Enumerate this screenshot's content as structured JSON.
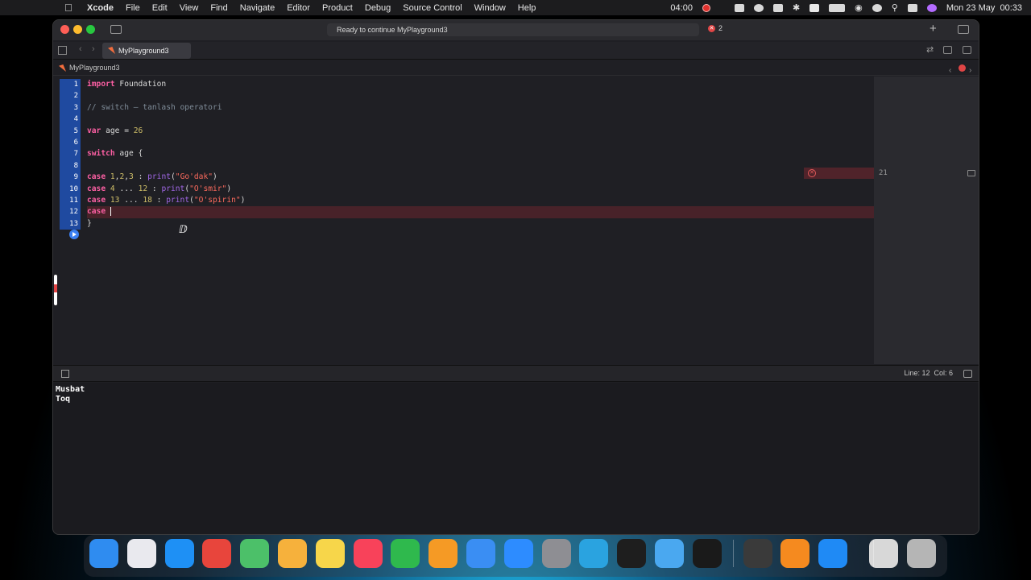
{
  "menubar": {
    "app_name": "Xcode",
    "items": [
      "File",
      "Edit",
      "View",
      "Find",
      "Navigate",
      "Editor",
      "Product",
      "Debug",
      "Source Control",
      "Window",
      "Help"
    ],
    "record_time": "04:00",
    "clock": "Mon 23 May  00:33"
  },
  "window": {
    "activity_text": "Ready to continue MyPlayground3",
    "error_count": "2",
    "tab_title": "MyPlayground3",
    "breadcrumb": "MyPlayground3"
  },
  "editor": {
    "lines": [
      {
        "n": "1",
        "tokens": [
          {
            "t": "kw",
            "v": "import"
          },
          {
            "t": "id",
            "v": " Foundation"
          }
        ]
      },
      {
        "n": "2",
        "tokens": []
      },
      {
        "n": "3",
        "tokens": [
          {
            "t": "cm",
            "v": "// switch – tanlash operatori"
          }
        ]
      },
      {
        "n": "4",
        "tokens": []
      },
      {
        "n": "5",
        "tokens": [
          {
            "t": "kw",
            "v": "var"
          },
          {
            "t": "id",
            "v": " age = "
          },
          {
            "t": "num",
            "v": "26"
          }
        ]
      },
      {
        "n": "6",
        "tokens": []
      },
      {
        "n": "7",
        "tokens": [
          {
            "t": "kw",
            "v": "switch"
          },
          {
            "t": "id",
            "v": " age {"
          }
        ]
      },
      {
        "n": "8",
        "tokens": []
      },
      {
        "n": "9",
        "tokens": [
          {
            "t": "kw",
            "v": "case"
          },
          {
            "t": "id",
            "v": " "
          },
          {
            "t": "num",
            "v": "1"
          },
          {
            "t": "id",
            "v": ","
          },
          {
            "t": "num",
            "v": "2"
          },
          {
            "t": "id",
            "v": ","
          },
          {
            "t": "num",
            "v": "3"
          },
          {
            "t": "id",
            "v": " : "
          },
          {
            "t": "fn",
            "v": "print"
          },
          {
            "t": "id",
            "v": "("
          },
          {
            "t": "str",
            "v": "\"Go'dak\""
          },
          {
            "t": "id",
            "v": ")"
          }
        ]
      },
      {
        "n": "10",
        "tokens": [
          {
            "t": "kw",
            "v": "case"
          },
          {
            "t": "id",
            "v": " "
          },
          {
            "t": "num",
            "v": "4"
          },
          {
            "t": "id",
            "v": " ... "
          },
          {
            "t": "num",
            "v": "12"
          },
          {
            "t": "id",
            "v": " : "
          },
          {
            "t": "fn",
            "v": "print"
          },
          {
            "t": "id",
            "v": "("
          },
          {
            "t": "str",
            "v": "\"O'smir\""
          },
          {
            "t": "id",
            "v": ")"
          }
        ]
      },
      {
        "n": "11",
        "tokens": [
          {
            "t": "kw",
            "v": "case"
          },
          {
            "t": "id",
            "v": " "
          },
          {
            "t": "num",
            "v": "13"
          },
          {
            "t": "id",
            "v": " ... "
          },
          {
            "t": "num",
            "v": "18"
          },
          {
            "t": "id",
            "v": " : "
          },
          {
            "t": "fn",
            "v": "print"
          },
          {
            "t": "id",
            "v": "("
          },
          {
            "t": "str",
            "v": "\"O'spirin\""
          },
          {
            "t": "id",
            "v": ")"
          }
        ]
      },
      {
        "n": "12",
        "tokens": [
          {
            "t": "kw",
            "v": "case"
          },
          {
            "t": "id",
            "v": " "
          }
        ],
        "caret": true,
        "error": true
      },
      {
        "n": "13",
        "tokens": [
          {
            "t": "id",
            "v": "}"
          }
        ]
      }
    ],
    "result_value": "21"
  },
  "statusbar": {
    "line_col": "Line: 12  Col: 6"
  },
  "console": {
    "output": [
      "Musbat",
      "Toq"
    ]
  },
  "colors": {
    "keyword": "#fc5fa3",
    "comment": "#7f8c98",
    "number": "#d0bf69",
    "string": "#fc6a5d",
    "function": "#a167e6",
    "line_number_bg": "#1f4aa0"
  },
  "dock": {
    "apps": [
      {
        "name": "finder-icon",
        "color": "#2f8cf0"
      },
      {
        "name": "launchpad-icon",
        "color": "#e9e9ee"
      },
      {
        "name": "app-store-icon",
        "color": "#1e90f5"
      },
      {
        "name": "chrome-icon",
        "color": "#e8453c"
      },
      {
        "name": "maps-icon",
        "color": "#4cc069"
      },
      {
        "name": "photos-icon",
        "color": "#f6b13c"
      },
      {
        "name": "notes-icon",
        "color": "#f7d64a"
      },
      {
        "name": "music-icon",
        "color": "#f8425a"
      },
      {
        "name": "numbers-icon",
        "color": "#2fb94d"
      },
      {
        "name": "pages-icon",
        "color": "#f59a25"
      },
      {
        "name": "xcode-icon",
        "color": "#3a8ef3"
      },
      {
        "name": "zoom-icon",
        "color": "#2d8cff"
      },
      {
        "name": "system-preferences-icon",
        "color": "#8e8e93"
      },
      {
        "name": "telegram-icon",
        "color": "#2aa3e0"
      },
      {
        "name": "figma-icon",
        "color": "#1e1e1e"
      },
      {
        "name": "simulator-icon",
        "color": "#4aa8f0"
      },
      {
        "name": "terminal-icon",
        "color": "#1a1a1a"
      },
      {
        "name": "keychain-icon",
        "color": "#3a3a3a"
      },
      {
        "name": "books-icon",
        "color": "#f58a1f"
      },
      {
        "name": "safari-icon",
        "color": "#1f8af5"
      },
      {
        "name": "downloads-icon",
        "color": "#d8d8d8"
      },
      {
        "name": "trash-icon",
        "color": "#b5b5b5"
      }
    ]
  }
}
